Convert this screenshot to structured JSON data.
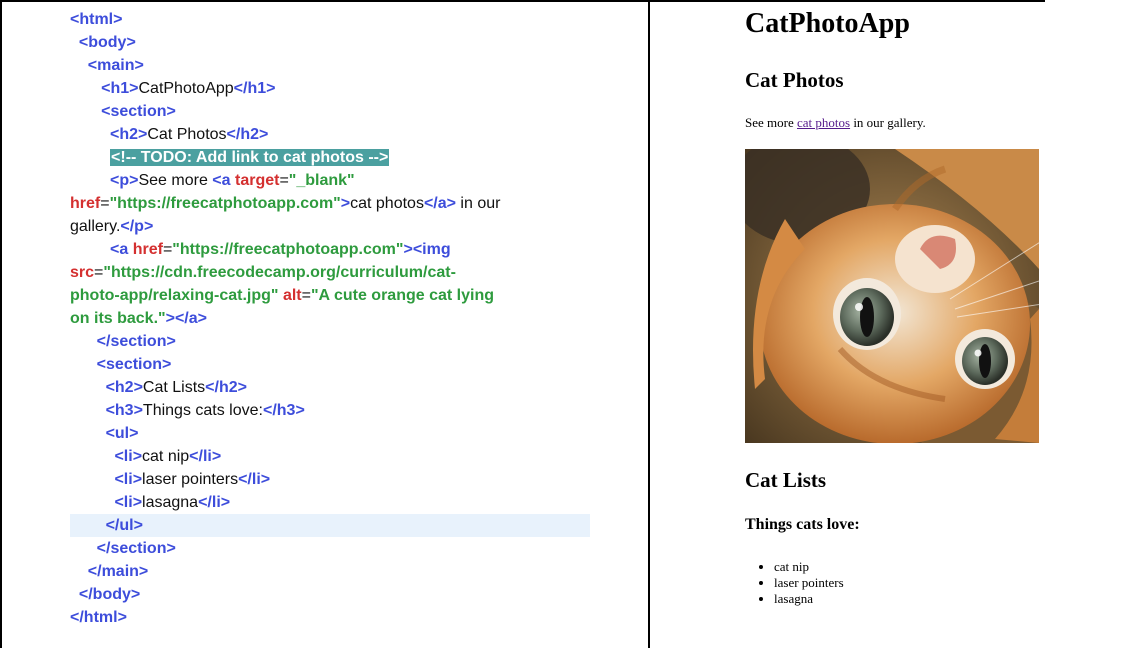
{
  "code_lines": [
    {
      "segments": [
        {
          "t": "tag",
          "v": "<html>"
        }
      ]
    },
    {
      "indent": "  ",
      "segments": [
        {
          "t": "tag",
          "v": "<body>"
        }
      ]
    },
    {
      "indent": "    ",
      "segments": [
        {
          "t": "tag",
          "v": "<main>"
        }
      ]
    },
    {
      "indent": "       ",
      "segments": [
        {
          "t": "tag",
          "v": "<h1>"
        },
        {
          "t": "txt",
          "v": "CatPhotoApp"
        },
        {
          "t": "tag",
          "v": "</h1>"
        }
      ]
    },
    {
      "indent": "       ",
      "segments": [
        {
          "t": "tag",
          "v": "<section>"
        }
      ]
    },
    {
      "indent": "         ",
      "segments": [
        {
          "t": "tag",
          "v": "<h2>"
        },
        {
          "t": "txt",
          "v": "Cat Photos"
        },
        {
          "t": "tag",
          "v": "</h2>"
        }
      ]
    },
    {
      "indent": "         ",
      "segments": [
        {
          "t": "comment",
          "v": "<!-- TODO: Add link to cat photos -->"
        }
      ]
    },
    {
      "indent": "         ",
      "wrap": true,
      "segments": [
        {
          "t": "tag",
          "v": "<p>"
        },
        {
          "t": "txt",
          "v": "See more "
        },
        {
          "t": "tag",
          "v": "<a "
        },
        {
          "t": "attr",
          "v": "target"
        },
        {
          "t": "eq",
          "v": "="
        },
        {
          "t": "str",
          "v": "\"_blank\""
        },
        {
          "t": "txt",
          "v": "\n"
        },
        {
          "t": "attr",
          "v": "href"
        },
        {
          "t": "eq",
          "v": "="
        },
        {
          "t": "str",
          "v": "\"https://freecatphotoapp.com\""
        },
        {
          "t": "tag",
          "v": ">"
        },
        {
          "t": "txt",
          "v": "cat photos"
        },
        {
          "t": "tag",
          "v": "</a>"
        },
        {
          "t": "txt",
          "v": " in our\ngallery."
        },
        {
          "t": "tag",
          "v": "</p>"
        }
      ]
    },
    {
      "indent": "         ",
      "wrap": true,
      "segments": [
        {
          "t": "tag",
          "v": "<a "
        },
        {
          "t": "attr",
          "v": "href"
        },
        {
          "t": "eq",
          "v": "="
        },
        {
          "t": "str",
          "v": "\"https://freecatphotoapp.com\""
        },
        {
          "t": "tag",
          "v": "><img"
        },
        {
          "t": "txt",
          "v": "\n"
        },
        {
          "t": "attr",
          "v": "src"
        },
        {
          "t": "eq",
          "v": "="
        },
        {
          "t": "str",
          "v": "\"https://cdn.freecodecamp.org/curriculum/cat-\nphoto-app/relaxing-cat.jpg\""
        },
        {
          "t": "txt",
          "v": " "
        },
        {
          "t": "attr",
          "v": "alt"
        },
        {
          "t": "eq",
          "v": "="
        },
        {
          "t": "str",
          "v": "\"A cute orange cat lying\non its back.\""
        },
        {
          "t": "tag",
          "v": "></a>"
        }
      ]
    },
    {
      "indent": "      ",
      "segments": [
        {
          "t": "tag",
          "v": "</section>"
        }
      ]
    },
    {
      "indent": "      ",
      "segments": [
        {
          "t": "tag",
          "v": "<section>"
        }
      ]
    },
    {
      "indent": "        ",
      "segments": [
        {
          "t": "tag",
          "v": "<h2>"
        },
        {
          "t": "txt",
          "v": "Cat Lists"
        },
        {
          "t": "tag",
          "v": "</h2>"
        }
      ]
    },
    {
      "indent": "        ",
      "segments": [
        {
          "t": "tag",
          "v": "<h3>"
        },
        {
          "t": "txt",
          "v": "Things cats love:"
        },
        {
          "t": "tag",
          "v": "</h3>"
        }
      ]
    },
    {
      "indent": "        ",
      "segments": [
        {
          "t": "tag",
          "v": "<ul>"
        }
      ]
    },
    {
      "indent": "          ",
      "segments": [
        {
          "t": "tag",
          "v": "<li>"
        },
        {
          "t": "txt",
          "v": "cat nip"
        },
        {
          "t": "tag",
          "v": "</li>"
        }
      ]
    },
    {
      "indent": "          ",
      "segments": [
        {
          "t": "tag",
          "v": "<li>"
        },
        {
          "t": "txt",
          "v": "laser pointers"
        },
        {
          "t": "tag",
          "v": "</li>"
        }
      ]
    },
    {
      "indent": "          ",
      "segments": [
        {
          "t": "tag",
          "v": "<li>"
        },
        {
          "t": "txt",
          "v": "lasagna"
        },
        {
          "t": "tag",
          "v": "</li>"
        }
      ]
    },
    {
      "indent": "        ",
      "highlight": true,
      "segments": [
        {
          "t": "tag",
          "v": "</ul>"
        }
      ]
    },
    {
      "indent": "      ",
      "segments": [
        {
          "t": "tag",
          "v": "</section>"
        }
      ]
    },
    {
      "indent": "    ",
      "segments": [
        {
          "t": "tag",
          "v": "</main>"
        }
      ]
    },
    {
      "indent": "  ",
      "segments": [
        {
          "t": "tag",
          "v": "</body>"
        }
      ]
    },
    {
      "segments": [
        {
          "t": "tag",
          "v": "</html>"
        }
      ]
    }
  ],
  "preview": {
    "h1": "CatPhotoApp",
    "section1_h2": "Cat Photos",
    "para_before": "See more ",
    "para_link": "cat photos",
    "para_after": " in our gallery.",
    "image_alt": "A cute orange cat lying on its back.",
    "section2_h2": "Cat Lists",
    "h3": "Things cats love:",
    "list_items": [
      "cat nip",
      "laser pointers",
      "lasagna"
    ]
  },
  "colors": {
    "tag": "#3d4ddb",
    "attr": "#d43030",
    "string": "#2e9b3e",
    "comment_bg": "#4ba0a0",
    "highlight_line": "#e8f2fc",
    "visited_link": "#551a8b"
  }
}
